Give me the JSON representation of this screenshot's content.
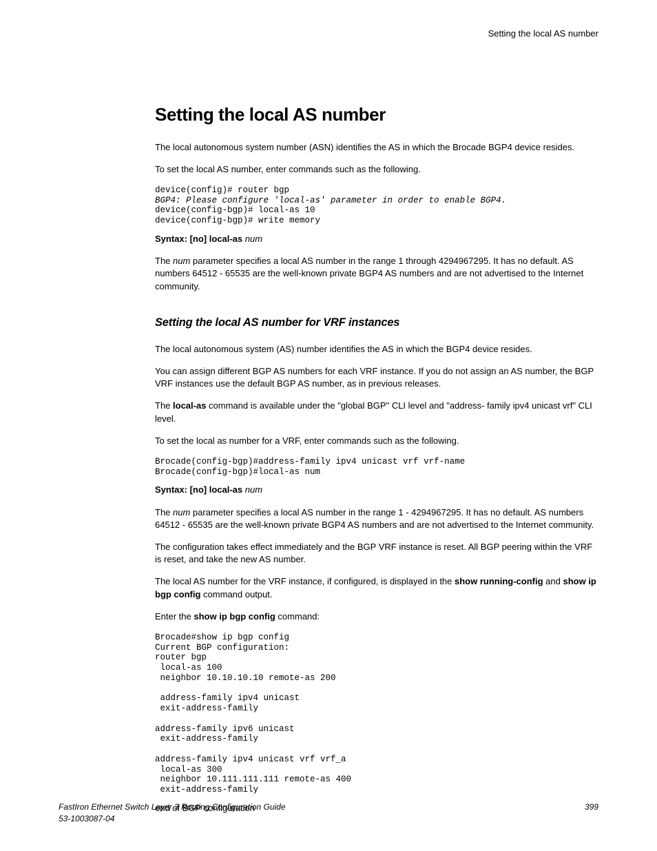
{
  "running_header": "Setting the local AS number",
  "h1": "Setting the local AS number",
  "p1": "The local autonomous system number (ASN) identifies the AS in which the Brocade BGP4 device resides.",
  "p2": "To set the local AS number, enter commands such as the following.",
  "code1_l1": "device(config)# router bgp",
  "code1_l2": "BGP4: Please configure 'local-as' parameter in order to enable BGP4.",
  "code1_l3": "device(config-bgp)# local-as 10",
  "code1_l4": "device(config-bgp)# write memory",
  "syntax1_b": "Syntax: [no] local-as",
  "syntax1_i": "num",
  "p3_pre": "The ",
  "p3_i": "num",
  "p3_post": " parameter specifies a local AS number in the range 1 through 4294967295. It has no default. AS numbers 64512 - 65535 are the well-known private BGP4 AS numbers and are not advertised to the Internet community.",
  "h2": "Setting the local AS number for VRF instances",
  "p4": "The local autonomous system (AS) number identifies the AS in which the BGP4 device resides.",
  "p5": "You can assign different BGP AS numbers for each VRF instance. If you do not assign an AS number, the BGP VRF instances use the default BGP AS number, as in previous releases.",
  "p6_pre": "The ",
  "p6_b": "local-as",
  "p6_post": " command is available under the \"global BGP\" CLI level and \"address- family ipv4 unicast vrf\" CLI level.",
  "p7": "To set the local as number for a VRF, enter commands such as the following.",
  "code2": "Brocade(config-bgp)#address-family ipv4 unicast vrf vrf-name\nBrocade(config-bgp)#local-as num",
  "syntax2_b": "Syntax: [no] local-as",
  "syntax2_i": "num",
  "p8_pre": "The ",
  "p8_i": "num",
  "p8_post": " parameter specifies a local AS number in the range 1 - 4294967295. It has no default. AS numbers 64512 - 65535 are the well-known private BGP4 AS numbers and are not advertised to the Internet community.",
  "p9": "The configuration takes effect immediately and the BGP VRF instance is reset. All BGP peering within the VRF is reset, and take the new AS number.",
  "p10_pre": "The local AS number for the VRF instance, if configured, is displayed in the ",
  "p10_b1": "show running-config",
  "p10_mid": " and ",
  "p10_b2": "show ip bgp config",
  "p10_post": " command output.",
  "p11_pre": "Enter the ",
  "p11_b": "show ip bgp config",
  "p11_post": " command:",
  "code3": "Brocade#show ip bgp config\nCurrent BGP configuration:\nrouter bgp\n local-as 100\n neighbor 10.10.10.10 remote-as 200\n\n address-family ipv4 unicast\n exit-address-family\n\naddress-family ipv6 unicast\n exit-address-family\n\naddress-family ipv4 unicast vrf vrf_a\n local-as 300\n neighbor 10.111.111.111 remote-as 400\n exit-address-family",
  "p12": "end of BGP configuration",
  "footer_title": "FastIron Ethernet Switch Layer 3 Routing Configuration Guide",
  "footer_doc": "53-1003087-04",
  "footer_page": "399"
}
